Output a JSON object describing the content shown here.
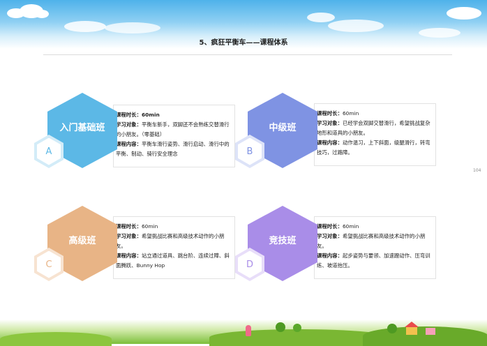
{
  "page": {
    "title": "5、疯狂平衡车——课程体系",
    "page_number": "104"
  },
  "courses": [
    {
      "name": "入门基础班",
      "letter": "A",
      "color": "#5cb8e6",
      "duration_label": "课程时长：",
      "duration": "60min",
      "audience_label": "学习对象：",
      "audience": "平衡车新手，双脚还不会熟练交替滑行的小朋友。（零基础）",
      "content_label": "课程内容：",
      "content": "平衡车滑行姿势、滑行启动、滑行中的平衡、制动、骑行安全理念"
    },
    {
      "name": "中级班",
      "letter": "B",
      "color": "#7f93e3",
      "duration_label": "课程时长：",
      "duration": "60min",
      "audience_label": "学习对象：",
      "audience": "已经学会双脚交替滑行，希望挑战复杂地形和道具的小朋友。",
      "content_label": "课程内容：",
      "content": "动作温习，上下斜面，级腿滑行，转弯技巧，过路障。"
    },
    {
      "name": "高级班",
      "letter": "C",
      "color": "#e8b486",
      "duration_label": "课程时长：",
      "duration": "60min",
      "audience_label": "学习对象：",
      "audience": "希望挑战比赛和高级技术动作的小朋友。",
      "content_label": "课程内容：",
      "content": "站立通过道具、跳台阶、连续过障、斜面腾跃、Bunny Hop"
    },
    {
      "name": "竞技班",
      "letter": "D",
      "color": "#a98de8",
      "duration_label": "课程时长：",
      "duration": "60min",
      "audience_label": "学习对象：",
      "audience": "希望挑战比赛和高级技术动作的小朋友。",
      "content_label": "课程内容：",
      "content": "起步姿势与要领、加速蹬动作、压弯训练、坡道抬压。"
    }
  ]
}
